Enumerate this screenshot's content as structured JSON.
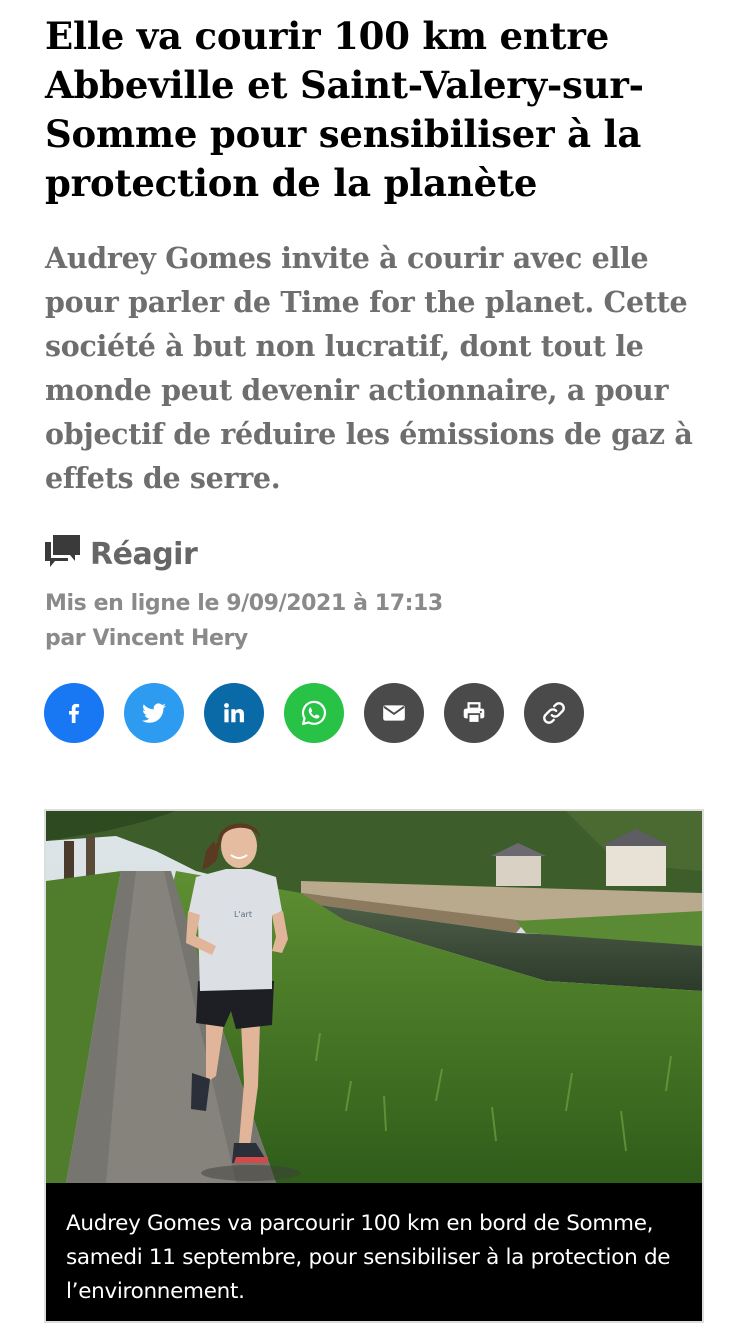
{
  "article": {
    "headline": "Elle va courir 100 km entre Abbeville et Saint-Valery-sur-Somme pour sensibiliser à la protection de la planète",
    "lede": "Audrey Gomes invite à courir avec elle pour parler de Time for the planet. Cette société à but non lucratif, dont tout le monde peut devenir actionnaire, a pour objectif de réduire les émissions de gaz à effets de serre.",
    "react_label": "Réagir",
    "published": "Mis en ligne le 9/09/2021 à 17:13",
    "author": "par Vincent Hery"
  },
  "share": {
    "buttons": [
      {
        "icon": "facebook-icon",
        "color": "#1877f2"
      },
      {
        "icon": "twitter-icon",
        "color": "#2d9cf0"
      },
      {
        "icon": "linkedin-icon",
        "color": "#0a6aa8"
      },
      {
        "icon": "whatsapp-icon",
        "color": "#28c246"
      },
      {
        "icon": "email-icon",
        "color": "#4a4a4a"
      },
      {
        "icon": "print-icon",
        "color": "#4a4a4a"
      },
      {
        "icon": "link-icon",
        "color": "#4a4a4a"
      }
    ]
  },
  "photo": {
    "caption": "Audrey Gomes va parcourir 100 km en bord de Somme, samedi 11 septembre, pour sensibiliser à la protection de l’environnement."
  }
}
